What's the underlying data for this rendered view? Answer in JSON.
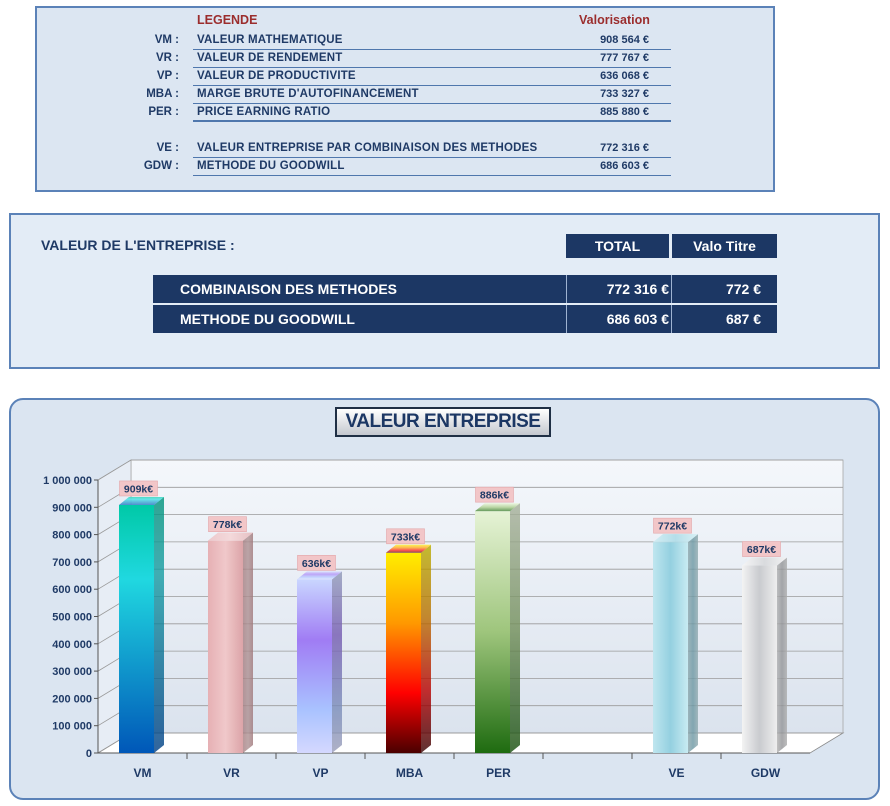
{
  "legend": {
    "header_label": "LEGENDE",
    "header_value": "Valorisation",
    "rows": [
      {
        "abbr": "VM :",
        "label": "VALEUR MATHEMATIQUE",
        "value": "908 564 €"
      },
      {
        "abbr": "VR :",
        "label": "VALEUR DE RENDEMENT",
        "value": "777 767 €"
      },
      {
        "abbr": "VP :",
        "label": "VALEUR DE PRODUCTIVITE",
        "value": "636 068 €"
      },
      {
        "abbr": "MBA :",
        "label": "MARGE BRUTE D'AUTOFINANCEMENT",
        "value": "733 327 €"
      },
      {
        "abbr": "PER :",
        "label": "PRICE EARNING RATIO",
        "value": "885 880 €"
      },
      {
        "abbr": "VE :",
        "label": "VALEUR ENTREPRISE PAR COMBINAISON DES METHODES",
        "value": "772 316 €"
      },
      {
        "abbr": "GDW :",
        "label": "METHODE DU GOODWILL",
        "value": "686 603 €"
      }
    ]
  },
  "valeur": {
    "title": "VALEUR DE L'ENTREPRISE :",
    "col_total": "TOTAL",
    "col_titre": "Valo Titre",
    "rows": [
      {
        "label": "COMBINAISON DES METHODES",
        "total": "772 316 €",
        "titre": "772 €"
      },
      {
        "label": "METHODE DU GOODWILL",
        "total": "686 603 €",
        "titre": "687 €"
      }
    ]
  },
  "chart_data": {
    "type": "bar",
    "title": "VALEUR ENTREPRISE",
    "categories": [
      "VM",
      "VR",
      "VP",
      "MBA",
      "PER",
      "",
      "VE",
      "GDW"
    ],
    "values": [
      908564,
      777767,
      636068,
      733327,
      885880,
      null,
      772316,
      686603
    ],
    "data_labels": [
      "909k€",
      "778k€",
      "636k€",
      "733k€",
      "886k€",
      "",
      "772k€",
      "687k€"
    ],
    "y_ticks": [
      "0",
      "100 000",
      "200 000",
      "300 000",
      "400 000",
      "500 000",
      "600 000",
      "700 000",
      "800 000",
      "900 000",
      "1 000 000"
    ],
    "ylim": [
      0,
      1000000
    ],
    "grid": true,
    "xlabel": "",
    "ylabel": "",
    "colors": {
      "VM": "#1ab3c4",
      "VR": "#e8b9bb",
      "VP": "#b08cf0",
      "MBA": "#ff8a00",
      "PER": "#8fb86a",
      "VE": "#a9dbe8",
      "GDW": "#e0e1e4",
      "axis_text": "#1f3a66",
      "label_bg": "#f2c6c8"
    }
  }
}
